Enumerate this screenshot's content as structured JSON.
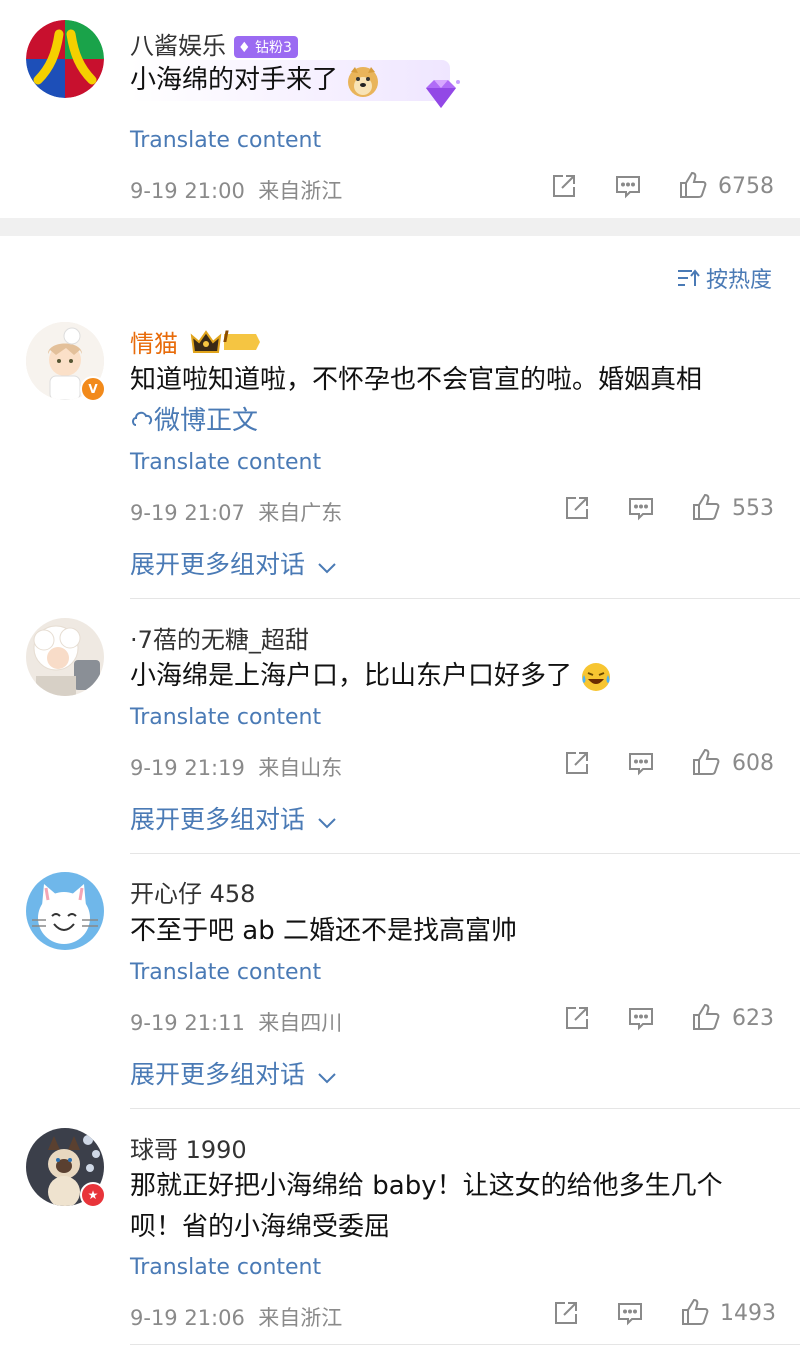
{
  "translate_label": "Translate content",
  "expand_label": "展开更多组对话",
  "sort_label": "按热度",
  "top_comment": {
    "name": "八酱娱乐",
    "badge": "钻粉3",
    "text": "小海绵的对手来了",
    "time": "9-19 21:00",
    "location": "来自浙江",
    "likes": "6758"
  },
  "comments": [
    {
      "name": "情猫",
      "level": "I",
      "text": "知道啦知道啦，不怀孕也不会官宣的啦。婚姻真相",
      "link": "微博正文",
      "time": "9-19 21:07",
      "location": "来自广东",
      "likes": "553"
    },
    {
      "name": "·7蓓的无糖_超甜",
      "text": "小海绵是上海户口，比山东户口好多了",
      "time": "9-19 21:19",
      "location": "来自山东",
      "likes": "608"
    },
    {
      "name": "开心仔 458",
      "text": "不至于吧 ab 二婚还不是找高富帅",
      "time": "9-19 21:11",
      "location": "来自四川",
      "likes": "623"
    },
    {
      "name": "球哥 1990",
      "text": "那就正好把小海绵给 baby！让这女的给他多生几个呗！省的小海绵受委屈",
      "time": "9-19 21:06",
      "location": "来自浙江",
      "likes": "1493"
    }
  ],
  "colors": {
    "link": "#4a7ab5",
    "orange_name": "#e86b0a",
    "badge_purple": "#9b6bf2",
    "meta_gray": "#8a8a8a"
  }
}
